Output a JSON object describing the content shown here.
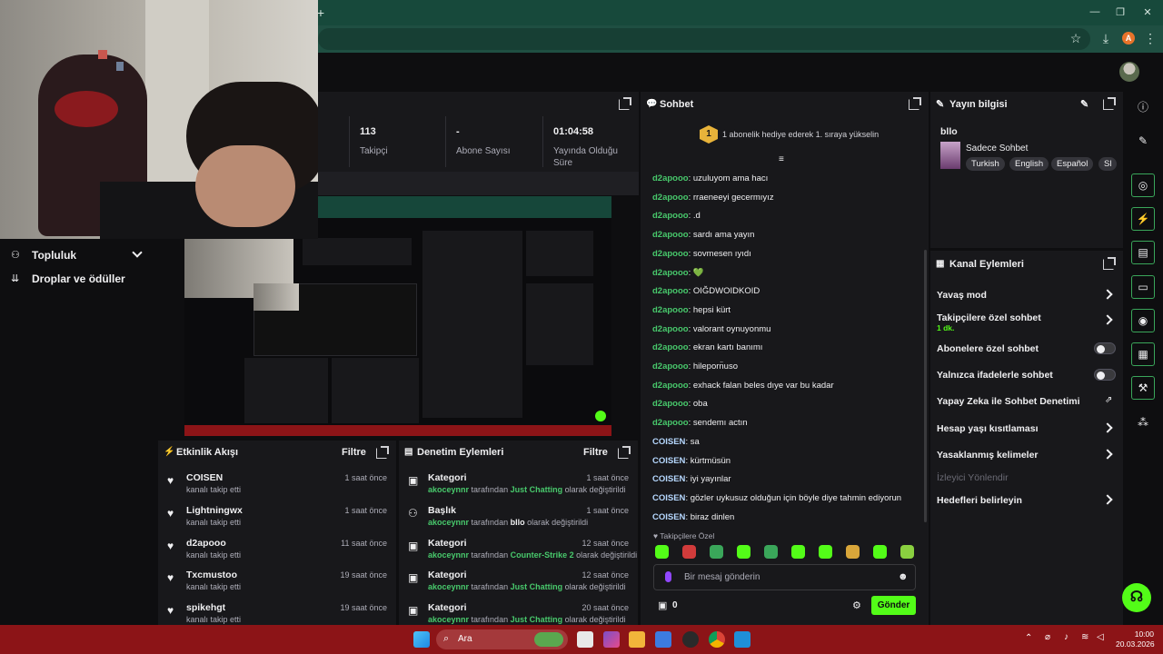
{
  "browser": {
    "new_tab": "+",
    "controls": [
      "—",
      "❐",
      "✕"
    ],
    "profile_initial": "A"
  },
  "sidebar": {
    "items": [
      {
        "label": "Topluluk",
        "icon": "people-icon"
      },
      {
        "label": "Droplar ve ödüller",
        "icon": "drops-icon"
      }
    ]
  },
  "stats": {
    "followers_value": "113",
    "followers_label": "Takipçi",
    "subs_value": "-",
    "subs_label": "Abone Sayısı",
    "uptime_value": "01:04:58",
    "uptime_label": "Yayında Olduğu Süre"
  },
  "chat": {
    "title": "Sohbet",
    "hype_rank": "1",
    "hype_text": "1 abonelik hediye ederek 1. sıraya yükselin",
    "messages": [
      {
        "user": "d2apooo",
        "text": "uzuluyom ama hacı",
        "color": "#48c96c"
      },
      {
        "user": "d2apooo",
        "text": "rraeneeyi gecermıyız",
        "color": "#48c96c"
      },
      {
        "user": "d2apooo",
        "text": ".d",
        "color": "#48c96c"
      },
      {
        "user": "d2apooo",
        "text": "sardı ama yayın",
        "color": "#48c96c"
      },
      {
        "user": "d2apooo",
        "text": "sovmesen ıyıdı",
        "color": "#48c96c"
      },
      {
        "user": "d2apooo",
        "text": "💚",
        "color": "#48c96c"
      },
      {
        "user": "d2apooo",
        "text": "OIĞDWOIDKOID",
        "color": "#48c96c"
      },
      {
        "user": "d2apooo",
        "text": "hepsi kürt",
        "color": "#48c96c"
      },
      {
        "user": "d2apooo",
        "text": "valorant oynuyonmu",
        "color": "#48c96c"
      },
      {
        "user": "d2apooo",
        "text": "ekran kartı banımı",
        "color": "#48c96c"
      },
      {
        "user": "d2apooo",
        "text": "hileporn̈uso",
        "color": "#48c96c"
      },
      {
        "user": "d2apooo",
        "text": "exhack falan beles dıye var bu kadar",
        "color": "#48c96c"
      },
      {
        "user": "d2apooo",
        "text": "oba",
        "color": "#48c96c"
      },
      {
        "user": "d2apooo",
        "text": "sendemı actın",
        "color": "#48c96c"
      },
      {
        "user": "COISEN",
        "text": "sa",
        "color": "#b6d8ff"
      },
      {
        "user": "COISEN",
        "text": "kürtmüsün",
        "color": "#b6d8ff"
      },
      {
        "user": "COISEN",
        "text": "iyi yayınlar",
        "color": "#b6d8ff"
      },
      {
        "user": "COISEN",
        "text": "gözler uykusuz olduğun için böyle diye tahmin ediyorun",
        "color": "#b6d8ff"
      },
      {
        "user": "COISEN",
        "text": "biraz dinlen",
        "color": "#b6d8ff"
      }
    ],
    "followers_only_label": "Takipçilere Özel",
    "input_placeholder": "Bir mesaj gönderin",
    "points": "0",
    "send_label": "Gönder"
  },
  "stream_info": {
    "title": "Yayın bilgisi",
    "stream_title": "bllo",
    "category": "Sadece Sohbet",
    "tags": [
      "Turkish",
      "English",
      "Español",
      "Sl"
    ]
  },
  "channel_actions": {
    "title": "Kanal Eylemleri",
    "rows": [
      {
        "label": "Yavaş mod",
        "control": "chevron"
      },
      {
        "label": "Takipçilere özel sohbet",
        "sub": "1 dk.",
        "control": "chevron"
      },
      {
        "label": "Abonelere özel sohbet",
        "control": "toggle"
      },
      {
        "label": "Yalnızca ifadelerle sohbet",
        "control": "toggle"
      },
      {
        "label": "Yapay Zeka ile Sohbet Denetimi",
        "control": "external"
      },
      {
        "label": "Hesap yaşı kısıtlaması",
        "control": "chevron"
      },
      {
        "label": "Yasaklanmış kelimeler",
        "control": "chevron"
      },
      {
        "label": "İzleyici Yönlendir",
        "control": "disabled"
      },
      {
        "label": "Hedefleri belirleyin",
        "control": "chevron"
      }
    ]
  },
  "activity_feed": {
    "title": "Etkinlik Akışı",
    "filter_label": "Filtre",
    "items": [
      {
        "user": "COISEN",
        "action": "kanalı takip etti",
        "time": "1 saat önce"
      },
      {
        "user": "Lightningwx",
        "action": "kanalı takip etti",
        "time": "1 saat önce"
      },
      {
        "user": "d2apooo",
        "action": "kanalı takip etti",
        "time": "11 saat önce"
      },
      {
        "user": "Txcmustoo",
        "action": "kanalı takip etti",
        "time": "19 saat önce"
      },
      {
        "user": "spikehgt",
        "action": "kanalı takip etti",
        "time": "19 saat önce"
      }
    ]
  },
  "moderation": {
    "title": "Denetim Eylemleri",
    "filter_label": "Filtre",
    "items": [
      {
        "title": "Kategori",
        "actor": "akoceynnr",
        "mid": "tarafından",
        "value": "Just Chatting",
        "value_color": "#48c96c",
        "suffix": "olarak değiştirildi",
        "time": "1 saat önce"
      },
      {
        "title": "Başlık",
        "actor": "akoceynnr",
        "mid": "tarafından",
        "value": "bllo",
        "value_color": "#efeff1",
        "suffix": "olarak değiştirildi",
        "time": "1 saat önce"
      },
      {
        "title": "Kategori",
        "actor": "akoceynnr",
        "mid": "tarafından",
        "value": "Counter-Strike 2",
        "value_color": "#48c96c",
        "suffix": "olarak değiştirildi",
        "time": "12 saat önce"
      },
      {
        "title": "Kategori",
        "actor": "akoceynnr",
        "mid": "tarafından",
        "value": "Just Chatting",
        "value_color": "#48c96c",
        "suffix": "olarak değiştirildi",
        "time": "12 saat önce"
      },
      {
        "title": "Kategori",
        "actor": "akoceynnr",
        "mid": "tarafından",
        "value": "Just Chatting",
        "value_color": "#48c96c",
        "suffix": "olarak değiştirildi",
        "time": "20 saat önce"
      }
    ]
  },
  "taskbar": {
    "search_label": "Ara",
    "clock_time": "10:00",
    "clock_date": "20.03.2026"
  },
  "colors": {
    "accent": "#53fc18",
    "chat_green": "#48c96c",
    "panel": "#18181b",
    "taskbar": "#8c1417",
    "browser": "#17493b"
  }
}
